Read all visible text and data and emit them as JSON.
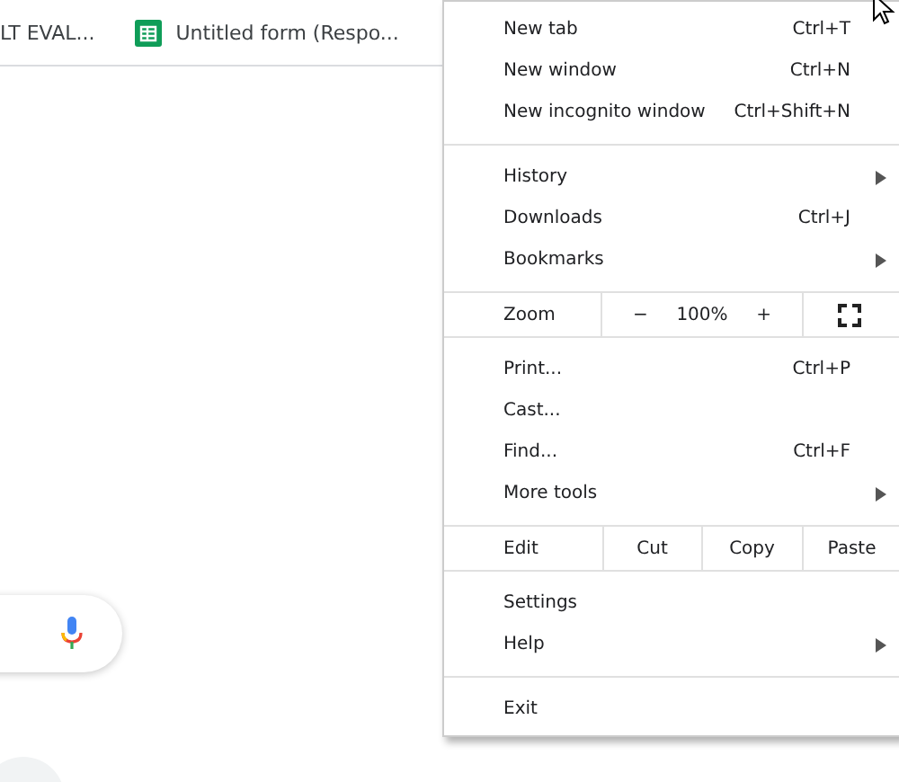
{
  "bookmarks_bar": [
    {
      "label": "LT EVAL...",
      "kind": "plain"
    },
    {
      "label": "Untitled form (Respo...",
      "kind": "sheet"
    }
  ],
  "menu": {
    "sections": [
      {
        "kind": "items",
        "items": [
          {
            "label": "New tab",
            "shortcut": "Ctrl+T",
            "submenu": false
          },
          {
            "label": "New window",
            "shortcut": "Ctrl+N",
            "submenu": false
          },
          {
            "label": "New incognito window",
            "shortcut": "Ctrl+Shift+N",
            "submenu": false
          }
        ]
      },
      {
        "kind": "items",
        "items": [
          {
            "label": "History",
            "submenu": true
          },
          {
            "label": "Downloads",
            "shortcut": "Ctrl+J",
            "submenu": false
          },
          {
            "label": "Bookmarks",
            "submenu": true
          }
        ]
      },
      {
        "kind": "zoom",
        "label": "Zoom",
        "minus": "−",
        "value": "100%",
        "plus": "+"
      },
      {
        "kind": "items",
        "items": [
          {
            "label": "Print...",
            "shortcut": "Ctrl+P",
            "submenu": false
          },
          {
            "label": "Cast...",
            "submenu": false
          },
          {
            "label": "Find...",
            "shortcut": "Ctrl+F",
            "submenu": false
          },
          {
            "label": "More tools",
            "submenu": true
          }
        ]
      },
      {
        "kind": "edit",
        "label": "Edit",
        "buttons": [
          "Cut",
          "Copy",
          "Paste"
        ]
      },
      {
        "kind": "items",
        "items": [
          {
            "label": "Settings",
            "submenu": false
          },
          {
            "label": "Help",
            "submenu": true
          }
        ]
      },
      {
        "kind": "items",
        "items": [
          {
            "label": "Exit",
            "submenu": false
          }
        ]
      }
    ]
  }
}
